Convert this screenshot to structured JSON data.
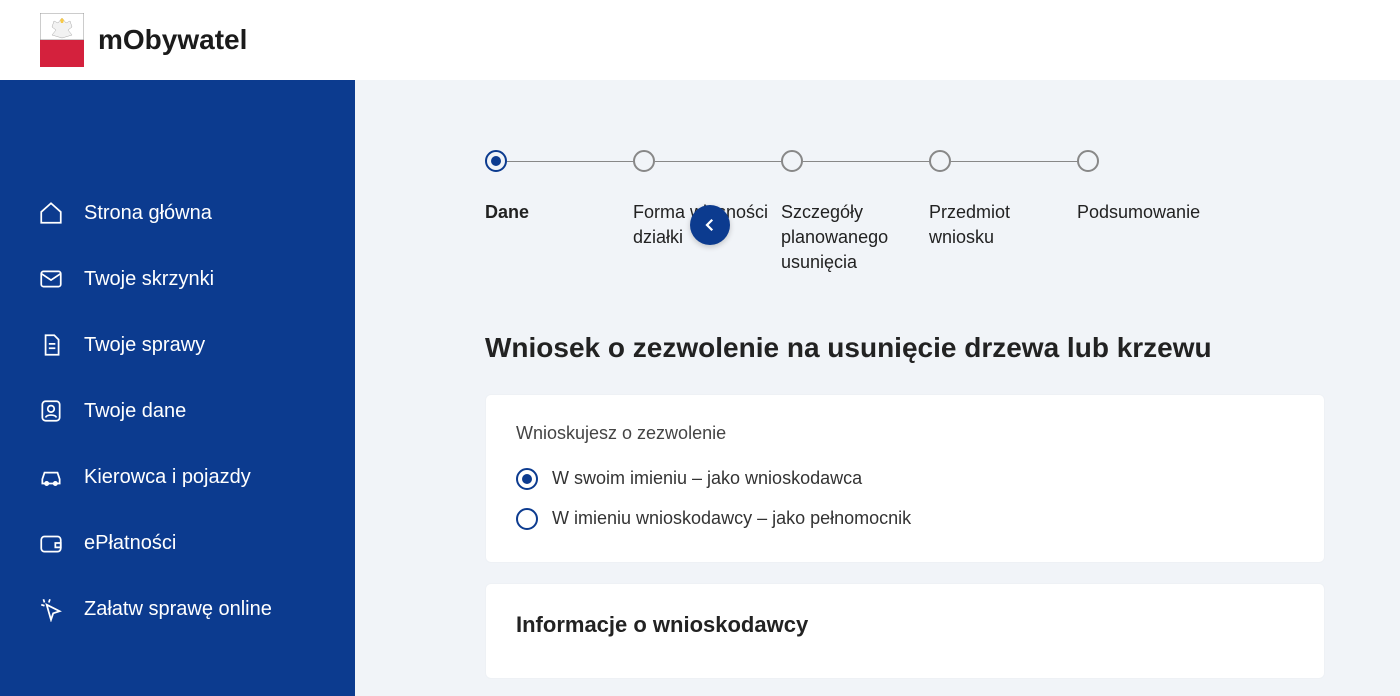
{
  "app": {
    "name": "mObywatel"
  },
  "sidebar": {
    "items": [
      {
        "icon": "home",
        "label": "Strona główna"
      },
      {
        "icon": "mail",
        "label": "Twoje skrzynki"
      },
      {
        "icon": "doc",
        "label": "Twoje sprawy"
      },
      {
        "icon": "user",
        "label": "Twoje dane"
      },
      {
        "icon": "car",
        "label": "Kierowca i pojazdy"
      },
      {
        "icon": "wallet",
        "label": "ePłatności"
      },
      {
        "icon": "cursor",
        "label": "Załatw sprawę online"
      }
    ]
  },
  "stepper": {
    "steps": [
      {
        "label": "Dane",
        "active": true
      },
      {
        "label": "Forma własności działki",
        "active": false
      },
      {
        "label": "Szczegóły planowanego usunięcia",
        "active": false
      },
      {
        "label": "Przedmiot wniosku",
        "active": false
      },
      {
        "label": "Podsumowanie",
        "active": false
      }
    ]
  },
  "page": {
    "title": "Wniosek o zezwolenie na usunięcie drzewa lub krzewu"
  },
  "form": {
    "permission": {
      "label": "Wnioskujesz o zezwolenie",
      "options": [
        {
          "label": "W swoim imieniu – jako wnioskodawca",
          "checked": true
        },
        {
          "label": "W imieniu wnioskodawcy – jako pełnomocnik",
          "checked": false
        }
      ]
    },
    "applicant": {
      "title": "Informacje o wnioskodawcy"
    }
  }
}
